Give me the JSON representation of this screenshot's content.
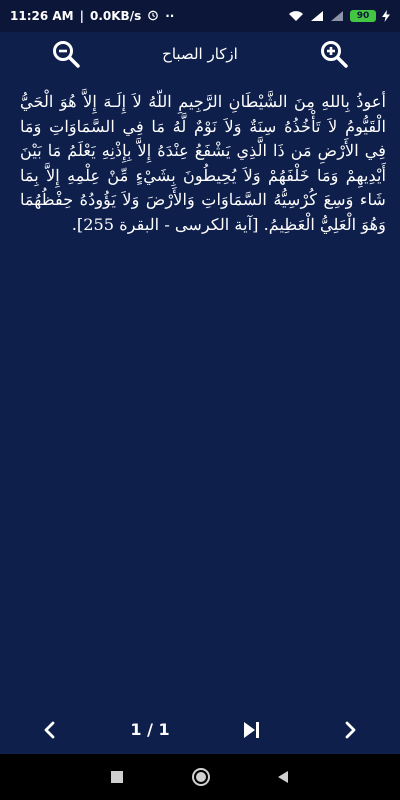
{
  "status_bar": {
    "time": "11:26 AM",
    "network_speed": "0.0KB/s",
    "alarm_icon": "alarm-clock-icon",
    "more_icon": "more-dots-icon",
    "wifi_icon": "wifi-icon",
    "signal_icon": "signal-icon",
    "battery_level": "90",
    "charging_icon": "charging-bolt-icon"
  },
  "app_bar": {
    "title": "ازكار الصباح",
    "zoom_out_icon": "zoom-out-icon",
    "zoom_in_icon": "zoom-in-icon"
  },
  "content": {
    "text": "أعوذُ بِاللهِ مِنَ الشَّيْطَانِ الرَّجِيمِ اللّهُ لاَ إِلَـهَ إِلاَّ هُوَ الْحَيُّ الْقَيُّومُ لاَ تَأْخُذُهُ سِنَةٌ وَلاَ نَوْمٌ لَّهُ مَا فِي السَّمَاوَاتِ وَمَا فِي الأَرْضِ مَن ذَا الَّذِي يَشْفَعُ عِنْدَهُ إِلاَّ بِإِذْنِهِ يَعْلَمُ مَا بَيْنَ أَيْدِيهِمْ وَمَا خَلْفَهُمْ وَلاَ يُحِيطُونَ بِشَيْءٍ مِّنْ عِلْمِهِ إِلاَّ بِمَا شَاء وَسِعَ كُرْسِيُّهُ السَّمَاوَاتِ وَالأَرْضَ وَلاَ يَؤُودُهُ حِفْظُهُمَا وَهُوَ الْعَلِيُّ الْعَظِيمُ. [آية الكرسى - البقرة 255]."
  },
  "pagination": {
    "page_indicator": "1 / 1",
    "prev_icon": "chevron-left-icon",
    "last_icon": "skip-to-end-icon",
    "next_icon": "chevron-right-icon"
  },
  "system_nav": {
    "recents_icon": "recents-square-icon",
    "home_icon": "home-circle-icon",
    "back_icon": "back-triangle-icon"
  },
  "colors": {
    "background": "#0f1f4b",
    "status_bar": "#0b1638",
    "text": "#ffffff",
    "battery": "#43c743",
    "system_nav": "#000000"
  }
}
